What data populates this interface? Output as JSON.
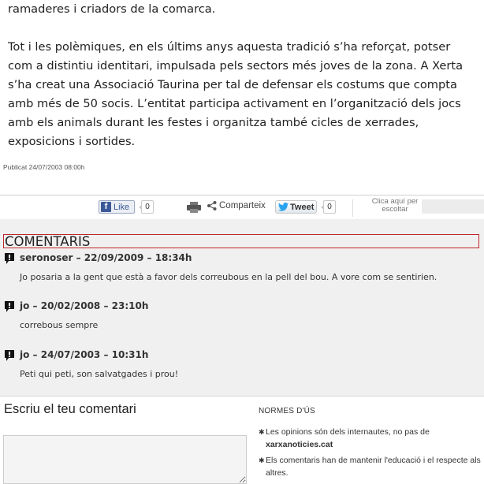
{
  "article": {
    "line_top": "ramaderes i criadors de la comarca.",
    "paragraph": "Tot i les polèmiques, en els últims anys aquesta tradició s’ha reforçat, potser com a distintiu identitari, impulsada pels sectors més joves de la zona. A Xerta s’ha creat una Associació Taurina per tal de defensar els costums que compta amb més de 50 socis. L’entitat participa activament en l’organització dels jocs amb els animals durant les festes i organitza també cicles de xerrades, exposicions i sortides.",
    "published": "Publicat 24/07/2003  08:00h"
  },
  "social": {
    "like_label": "Like",
    "like_count": "0",
    "share_label": "Comparteix",
    "tweet_label": "Tweet",
    "tweet_count": "0",
    "search_hint": "Clica aquí per escoltar"
  },
  "comments": {
    "title": "COMENTARIS",
    "items": [
      {
        "author_date": "seronoser – 22/09/2009 – 18:34h",
        "text": "Jo posaria a la gent que està a favor dels correubous en la pell del bou. A vore com se sentirien."
      },
      {
        "author_date": "jo – 20/02/2008 – 23:10h",
        "text": "correbous sempre"
      },
      {
        "author_date": "jo – 24/07/2003 – 10:31h",
        "text": "Peti qui peti, son salvatgades i prou!"
      }
    ]
  },
  "write": {
    "title": "Escriu el teu comentari"
  },
  "normes": {
    "title": "NORMES D'ÚS",
    "rule1_text": "Les opinions són dels internautes, no pas de",
    "rule1_bold": "xarxanoticies.cat",
    "rule2_text": "Els comentaris han de mantenir l'educació i el respecte als altres."
  },
  "icons": {
    "like": "facebook-icon",
    "print": "printer-icon",
    "share": "share-icon",
    "tweet": "twitter-bird-icon",
    "comment": "speech-bubble-icon"
  },
  "colors": {
    "accent": "#c0262b",
    "facebook": "#3b5998",
    "twitter": "#2aa3ef",
    "comments_bg": "#f0f0f0"
  }
}
